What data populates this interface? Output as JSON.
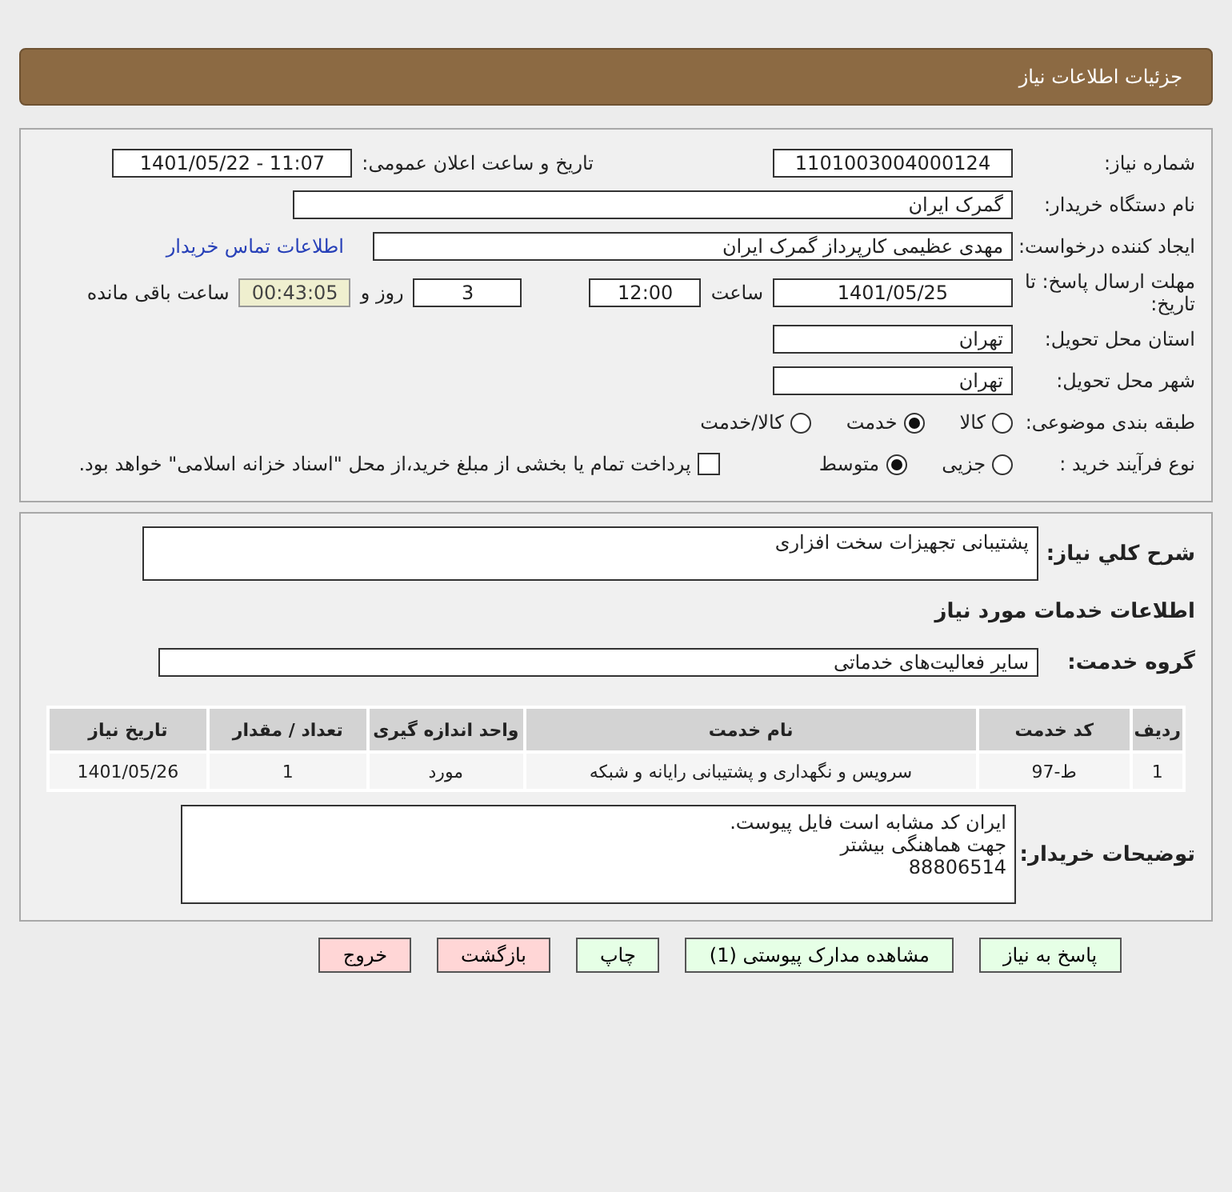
{
  "header": {
    "title": "جزئیات اطلاعات نیاز"
  },
  "details": {
    "need_number": {
      "label": "شماره نیاز:",
      "value": "1101003004000124"
    },
    "announce": {
      "label": "تاریخ و ساعت اعلان عمومی:",
      "value": "1401/05/22 - 11:07"
    },
    "buyer_org": {
      "label": "نام دستگاه خریدار:",
      "value": "گمرک ایران"
    },
    "creator": {
      "label": "ایجاد کننده درخواست:",
      "value": "مهدی عظیمی کارپرداز گمرک ایران",
      "link": "اطلاعات تماس خریدار"
    },
    "deadline": {
      "label": "مهلت ارسال پاسخ: تا تاریخ:",
      "date": "1401/05/25",
      "time_label": "ساعت",
      "time": "12:00",
      "days": "3",
      "days_label": "روز و",
      "remaining": "00:43:05",
      "remaining_label": "ساعت باقی مانده"
    },
    "province": {
      "label": "استان محل تحویل:",
      "value": "تهران"
    },
    "city": {
      "label": "شهر محل تحویل:",
      "value": "تهران"
    },
    "category": {
      "label": "طبقه بندی موضوعی:",
      "options": [
        {
          "label": "کالا",
          "selected": false
        },
        {
          "label": "خدمت",
          "selected": true
        },
        {
          "label": "کالا/خدمت",
          "selected": false
        }
      ]
    },
    "process": {
      "label": "نوع فرآیند خرید :",
      "options": [
        {
          "label": "جزیی",
          "selected": false
        },
        {
          "label": "متوسط",
          "selected": true
        }
      ],
      "treasury": {
        "label": "پرداخت تمام یا بخشی از مبلغ خرید،از محل \"اسناد خزانه اسلامی\" خواهد بود.",
        "checked": false
      }
    }
  },
  "services": {
    "summary": {
      "label": "شرح کلي نیاز:",
      "value": "پشتیبانی تجهیزات سخت افزاری"
    },
    "heading": "اطلاعات خدمات مورد نیاز",
    "group": {
      "label": "گروه خدمت:",
      "value": "سایر فعالیت‌های خدماتی"
    },
    "table": {
      "columns": [
        "ردیف",
        "کد خدمت",
        "نام خدمت",
        "واحد اندازه گیری",
        "تعداد / مقدار",
        "تاریخ نیاز"
      ],
      "rows": [
        [
          "1",
          "ط-97",
          "سرویس و نگهداری و پشتیبانی رایانه و شبکه",
          "مورد",
          "1",
          "1401/05/26"
        ]
      ]
    },
    "notes": {
      "label": "توضیحات خریدار:",
      "lines": [
        "ایران کد مشابه است فایل پیوست.",
        "جهت هماهنگی بیشتر",
        "88806514"
      ]
    }
  },
  "buttons": [
    {
      "label": "پاسخ به نیاز",
      "kind": "action"
    },
    {
      "label": "مشاهده مدارک پیوستی (1)",
      "kind": "action"
    },
    {
      "label": "چاپ",
      "kind": "action"
    },
    {
      "label": "بازگشت",
      "kind": "exit"
    },
    {
      "label": "خروج",
      "kind": "exit"
    }
  ]
}
